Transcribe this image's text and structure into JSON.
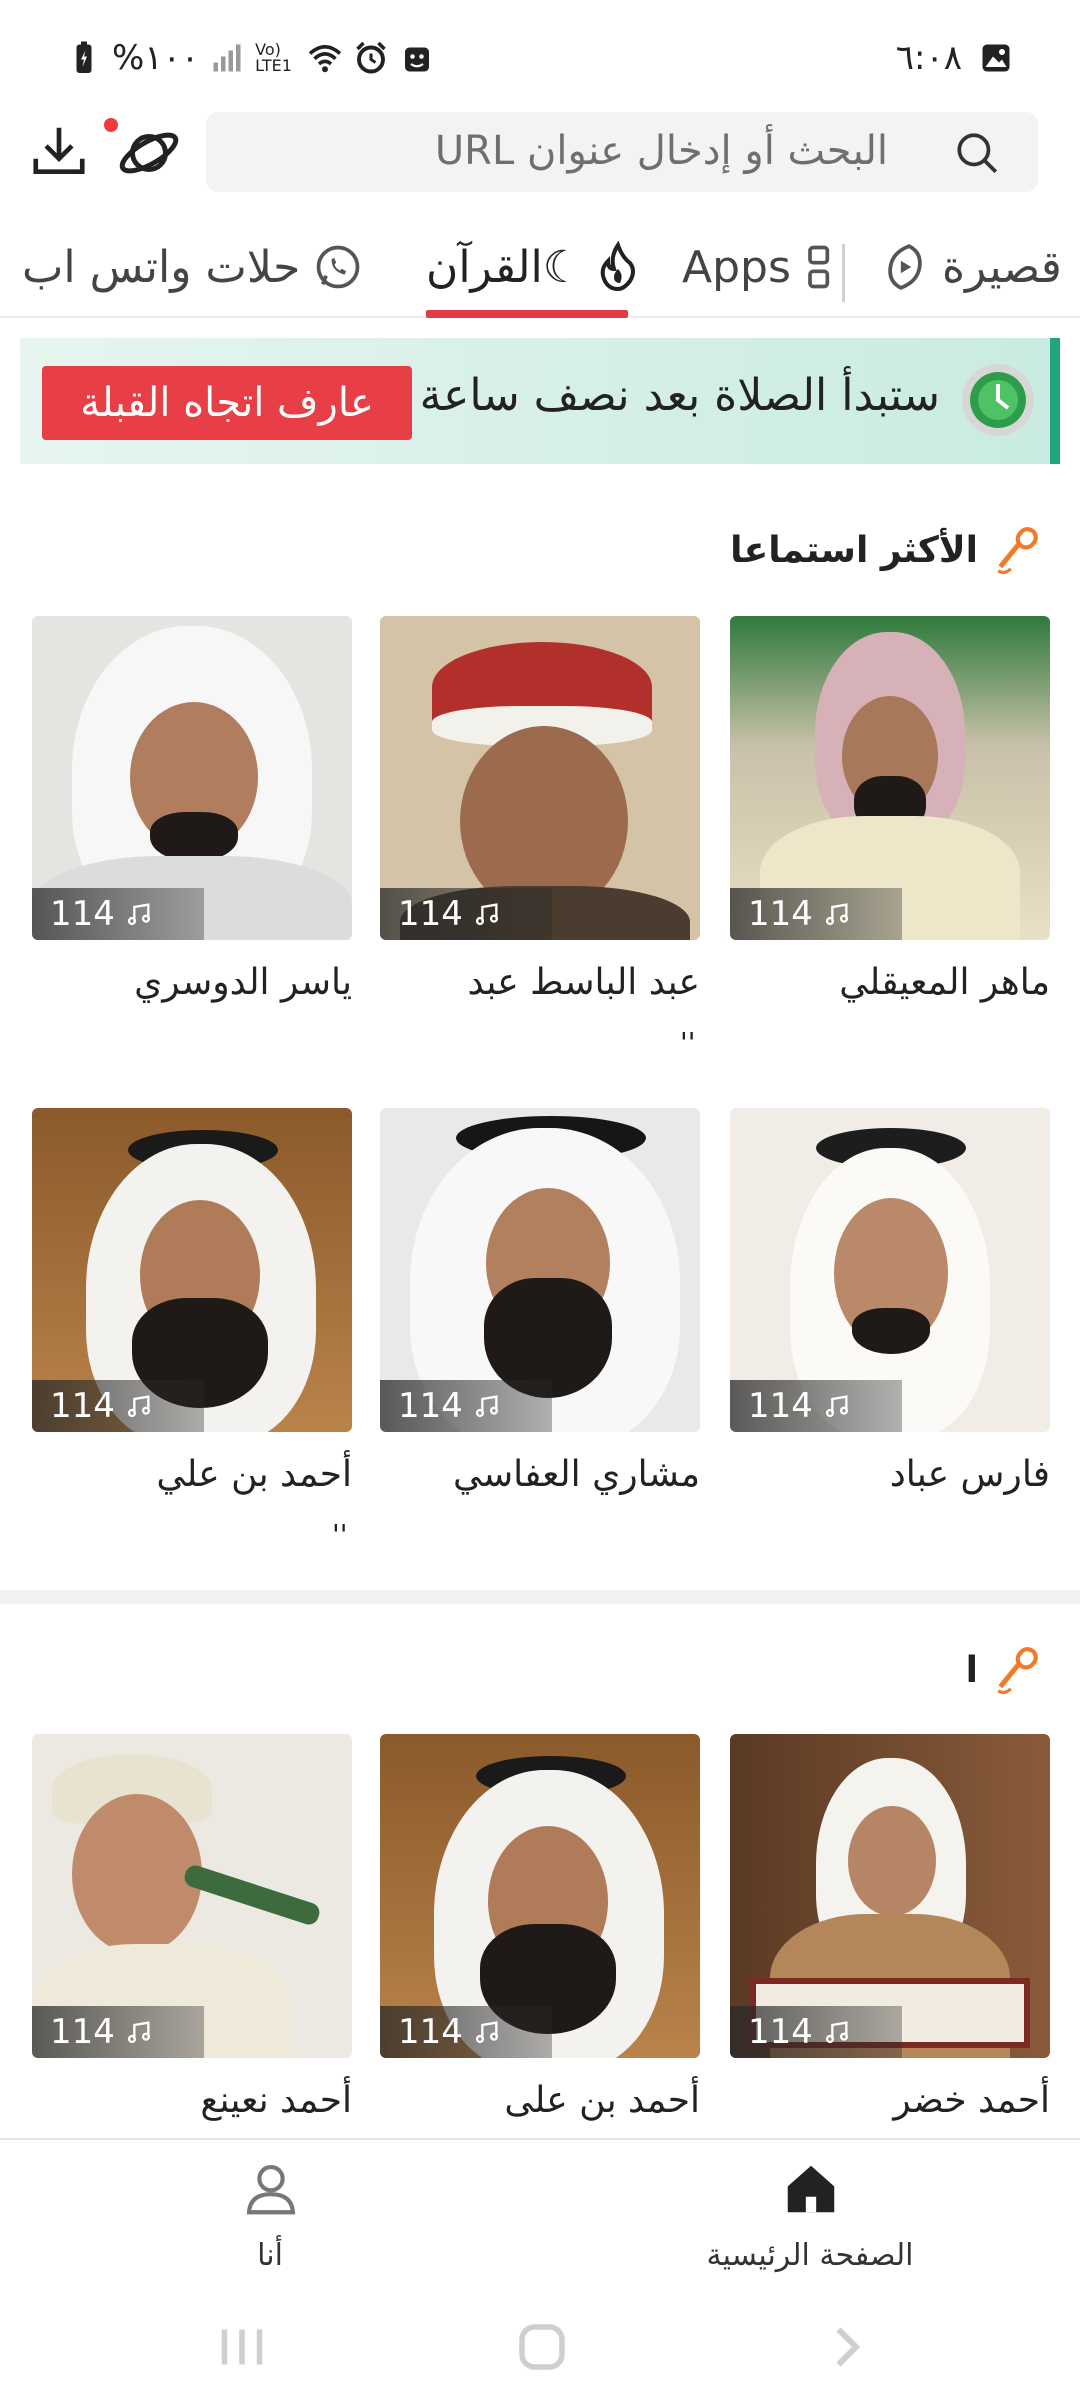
{
  "status_bar": {
    "time": "٦:٠٨",
    "battery": "%١٠٠",
    "network": "Vo) LTE1"
  },
  "search": {
    "placeholder": "البحث أو إدخال عنوان URL"
  },
  "tabs": [
    {
      "label": "حلات واتس اب",
      "icon": "whatsapp-icon"
    },
    {
      "label": "القرآن☾",
      "icon": "fire-icon",
      "active": true
    },
    {
      "label": "Apps",
      "icon": "apps-grid-icon"
    },
    {
      "label": "قصيرة",
      "icon": "short-video-icon"
    }
  ],
  "banner": {
    "text": "ستبدأ الصلاة بعد نصف ساعة",
    "button": "عارف اتجاه القبلة"
  },
  "sections": [
    {
      "title": "الأكثر استماعا",
      "cards": [
        {
          "name": "ماهر المعيقلي",
          "count": "114"
        },
        {
          "name": "عبد الباسط عبد",
          "count": "114",
          "quote": "''"
        },
        {
          "name": "ياسر الدوسري",
          "count": "114"
        },
        {
          "name": "فارس عباد",
          "count": "114"
        },
        {
          "name": "مشاري العفاسي",
          "count": "114"
        },
        {
          "name": "أحمد بن علي",
          "count": "114",
          "quote": "''"
        }
      ]
    },
    {
      "title": "ا",
      "cards": [
        {
          "name": "أحمد خضر",
          "count": "114"
        },
        {
          "name": "أحمد بن على",
          "count": "114"
        },
        {
          "name": "أحمد نعينع",
          "count": "114"
        }
      ]
    }
  ],
  "bottom_nav": {
    "home": "الصفحة الرئيسية",
    "me": "أنا"
  },
  "colors": {
    "accent": "#e33b45",
    "banner_green": "#20a57c",
    "mic_orange": "#f07a2a"
  }
}
